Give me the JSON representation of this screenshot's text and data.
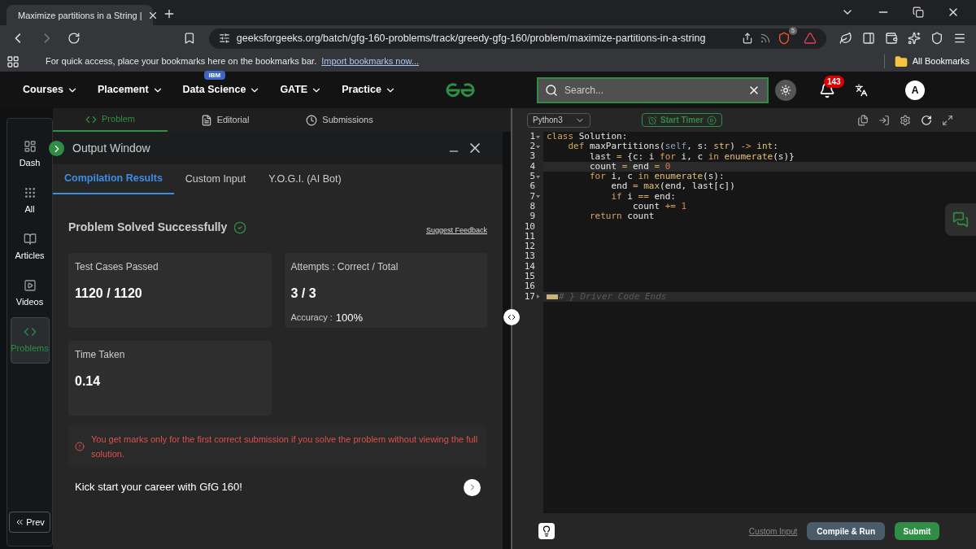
{
  "browser": {
    "tab_title": "Maximize partitions in a String |",
    "url": "geeksforgeeks.org/batch/gfg-160-problems/track/greedy-gfg-160/problem/maximize-partitions-in-a-string",
    "shield_count": "5",
    "bookmarks_hint": "For quick access, place your bookmarks here on the bookmarks bar.",
    "import_link": "Import bookmarks now...",
    "all_bookmarks": "All Bookmarks"
  },
  "site_nav": {
    "items": [
      {
        "label": "Courses"
      },
      {
        "label": "Placement"
      },
      {
        "label": "Data Science",
        "badge": "IBM"
      },
      {
        "label": "GATE"
      },
      {
        "label": "Practice"
      }
    ],
    "search_placeholder": "Search...",
    "notifications": "143",
    "avatar": "A"
  },
  "problem_tabs": [
    {
      "label": "Problem",
      "selected": true
    },
    {
      "label": "Editorial",
      "selected": false
    },
    {
      "label": "Submissions",
      "selected": false
    }
  ],
  "rail": {
    "items": [
      {
        "label": "Dash",
        "selected": false
      },
      {
        "label": "All",
        "selected": false
      },
      {
        "label": "Articles",
        "selected": false
      },
      {
        "label": "Videos",
        "selected": false
      },
      {
        "label": "Problems",
        "selected": true
      }
    ],
    "prev": "Prev"
  },
  "output_window": {
    "title": "Output Window",
    "tabs": [
      {
        "label": "Compilation Results",
        "selected": true
      },
      {
        "label": "Custom Input",
        "selected": false
      },
      {
        "label": "Y.O.G.I. (AI Bot)",
        "selected": false
      }
    ],
    "status": "Problem Solved Successfully",
    "feedback": "Suggest Feedback",
    "test_cases": {
      "label": "Test Cases Passed",
      "value": "1120 / 1120"
    },
    "attempts": {
      "label": "Attempts : Correct / Total",
      "value": "3 / 3",
      "accuracy_label": "Accuracy :",
      "accuracy": "100%"
    },
    "time": {
      "label": "Time Taken",
      "value": "0.14"
    },
    "notice": "You get marks only for the first correct submission if you solve the problem without viewing the full solution.",
    "promo": "Kick start your career with GfG 160!"
  },
  "editor": {
    "language": "Python3",
    "timer": "Start Timer",
    "lines": [
      {
        "number": "1",
        "foldable": true,
        "folded": false,
        "current": false,
        "tokens": [
          {
            "kind": "keyword",
            "text": "class "
          },
          {
            "kind": "plain",
            "text": "Solution:"
          }
        ]
      },
      {
        "number": "2",
        "foldable": true,
        "folded": false,
        "current": false,
        "tokens": [
          {
            "kind": "keyword",
            "text": "    def "
          },
          {
            "kind": "plain",
            "text": "maxPartitions("
          },
          {
            "kind": "self",
            "text": "self"
          },
          {
            "kind": "plain",
            "text": ", s: "
          },
          {
            "kind": "builtin",
            "text": "str"
          },
          {
            "kind": "plain",
            "text": ") "
          },
          {
            "kind": "operator",
            "text": "-> "
          },
          {
            "kind": "builtin",
            "text": "int"
          },
          {
            "kind": "plain",
            "text": ":"
          }
        ]
      },
      {
        "number": "3",
        "foldable": false,
        "folded": false,
        "current": false,
        "tokens": [
          {
            "kind": "plain",
            "text": "        last "
          },
          {
            "kind": "operator",
            "text": "="
          },
          {
            "kind": "plain",
            "text": " {c: i "
          },
          {
            "kind": "keyword",
            "text": "for"
          },
          {
            "kind": "plain",
            "text": " i, c "
          },
          {
            "kind": "keyword",
            "text": "in "
          },
          {
            "kind": "builtin",
            "text": "enumerate"
          },
          {
            "kind": "plain",
            "text": "(s)}"
          }
        ]
      },
      {
        "number": "4",
        "foldable": false,
        "folded": false,
        "current": true,
        "tokens": [
          {
            "kind": "plain",
            "text": "        count "
          },
          {
            "kind": "operator",
            "text": "="
          },
          {
            "kind": "plain",
            "text": " end "
          },
          {
            "kind": "operator",
            "text": "= "
          },
          {
            "kind": "number",
            "text": "0"
          }
        ]
      },
      {
        "number": "5",
        "foldable": true,
        "folded": false,
        "current": false,
        "tokens": [
          {
            "kind": "keyword",
            "text": "        for"
          },
          {
            "kind": "plain",
            "text": " i, c "
          },
          {
            "kind": "keyword",
            "text": "in "
          },
          {
            "kind": "builtin",
            "text": "enumerate"
          },
          {
            "kind": "plain",
            "text": "(s):"
          }
        ]
      },
      {
        "number": "6",
        "foldable": false,
        "folded": false,
        "current": false,
        "tokens": [
          {
            "kind": "plain",
            "text": "            end "
          },
          {
            "kind": "operator",
            "text": "= "
          },
          {
            "kind": "builtin",
            "text": "max"
          },
          {
            "kind": "plain",
            "text": "(end, last[c])"
          }
        ]
      },
      {
        "number": "7",
        "foldable": true,
        "folded": false,
        "current": false,
        "tokens": [
          {
            "kind": "keyword",
            "text": "            if"
          },
          {
            "kind": "plain",
            "text": " i "
          },
          {
            "kind": "operator",
            "text": "=="
          },
          {
            "kind": "plain",
            "text": " end:"
          }
        ]
      },
      {
        "number": "8",
        "foldable": false,
        "folded": false,
        "current": false,
        "tokens": [
          {
            "kind": "plain",
            "text": "                count "
          },
          {
            "kind": "operator",
            "text": "+= "
          },
          {
            "kind": "number",
            "text": "1"
          }
        ]
      },
      {
        "number": "9",
        "foldable": false,
        "folded": false,
        "current": false,
        "tokens": [
          {
            "kind": "keyword",
            "text": "        return"
          },
          {
            "kind": "plain",
            "text": " count"
          }
        ]
      },
      {
        "number": "10",
        "foldable": false,
        "folded": false,
        "current": false
      },
      {
        "number": "11",
        "foldable": false,
        "folded": false,
        "current": false
      },
      {
        "number": "12",
        "foldable": false,
        "folded": false,
        "current": false
      },
      {
        "number": "13",
        "foldable": false,
        "folded": false,
        "current": false
      },
      {
        "number": "14",
        "foldable": false,
        "folded": false,
        "current": false
      },
      {
        "number": "15",
        "foldable": false,
        "folded": false,
        "current": false
      },
      {
        "number": "16",
        "foldable": false,
        "folded": false,
        "current": false
      },
      {
        "number": "17",
        "foldable": true,
        "folded": true,
        "current": true,
        "tokens": [
          {
            "kind": "comment",
            "text": "# } Driver Code Ends"
          }
        ]
      }
    ],
    "custom_input": "Custom Input",
    "compile": "Compile & Run",
    "submit": "Submit"
  }
}
